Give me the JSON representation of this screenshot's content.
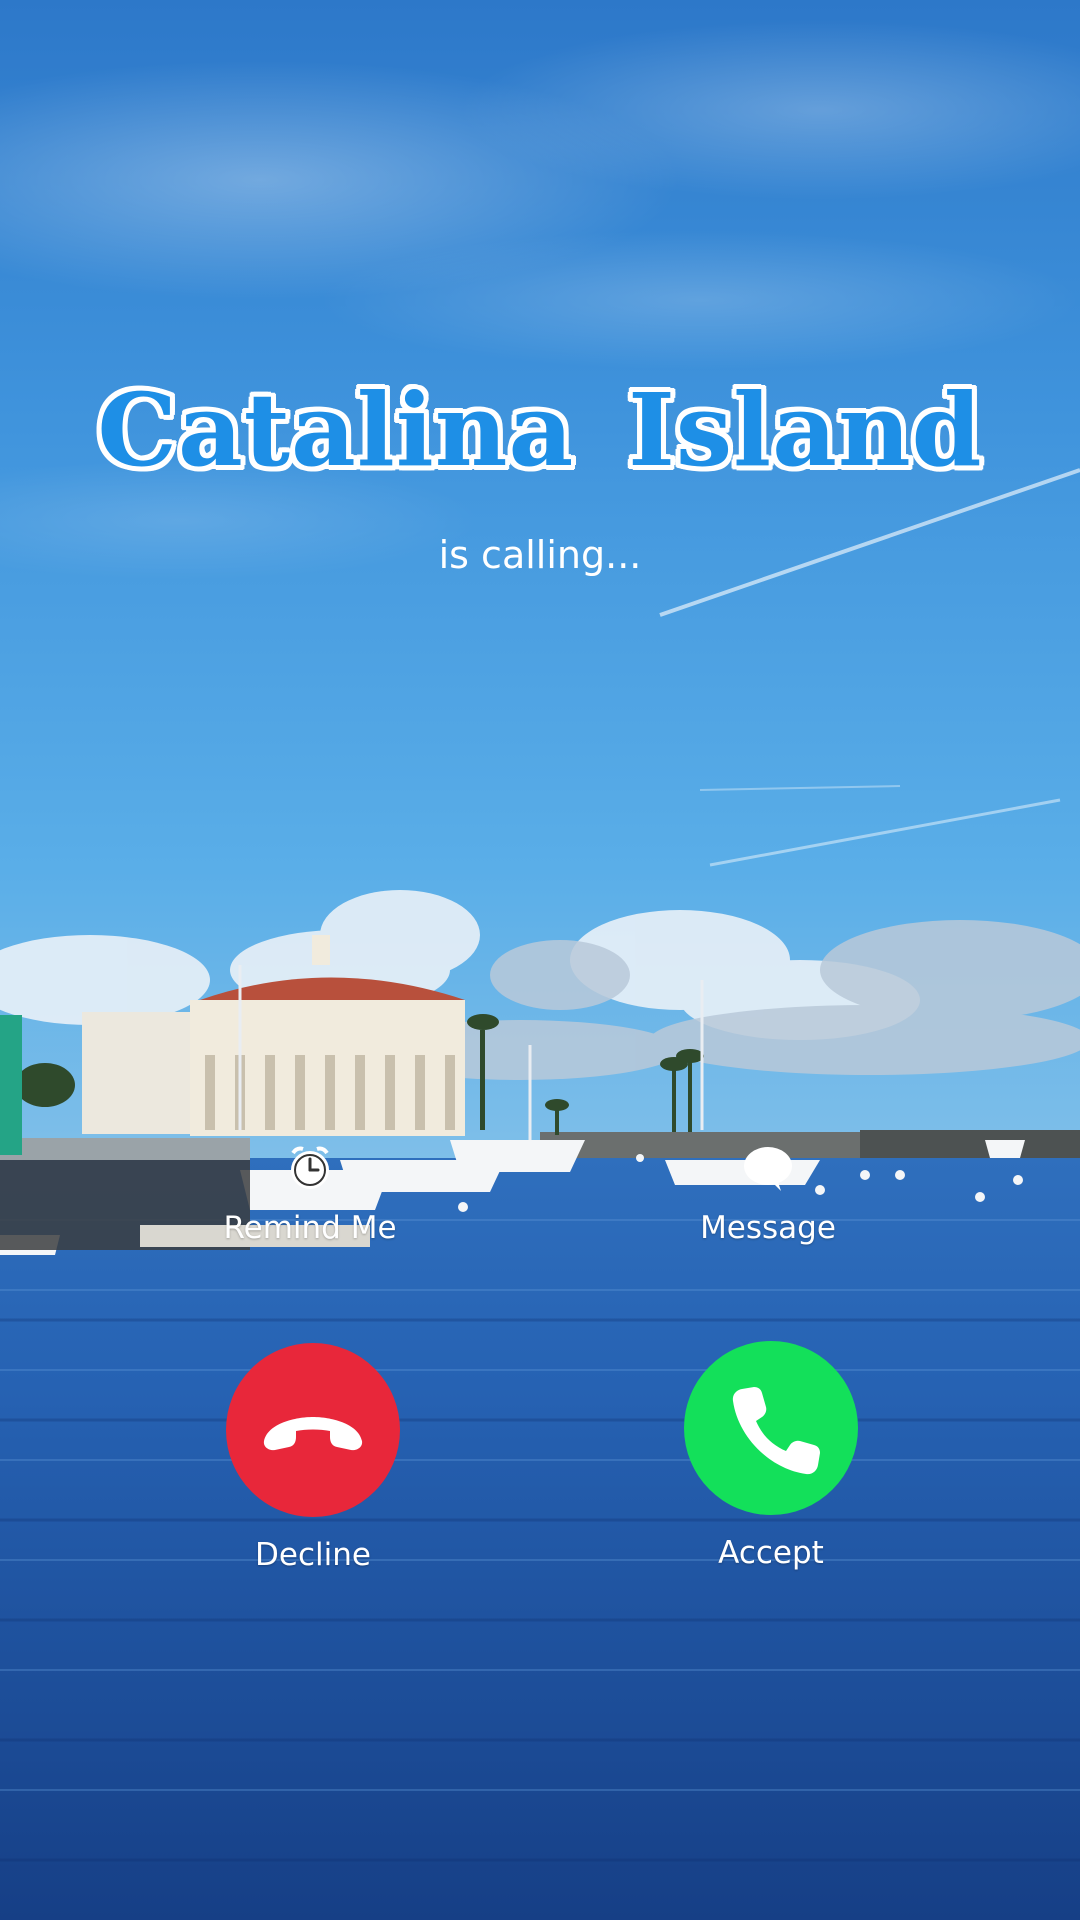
{
  "caller": {
    "name": "Catalina Island",
    "status": "is calling..."
  },
  "quick_actions": {
    "remind": {
      "label": "Remind Me",
      "icon": "alarm-clock-icon"
    },
    "message": {
      "label": "Message",
      "icon": "speech-bubble-icon"
    }
  },
  "call_actions": {
    "decline": {
      "label": "Decline",
      "icon": "phone-hangup-icon",
      "color": "#e8273a"
    },
    "accept": {
      "label": "Accept",
      "icon": "phone-icon",
      "color": "#13e05a"
    }
  },
  "colors": {
    "sky_top": "#2f7fd0",
    "sky_bottom": "#5aaee8",
    "water": "#1c56a6",
    "caller_name": "#1e8fe6"
  }
}
